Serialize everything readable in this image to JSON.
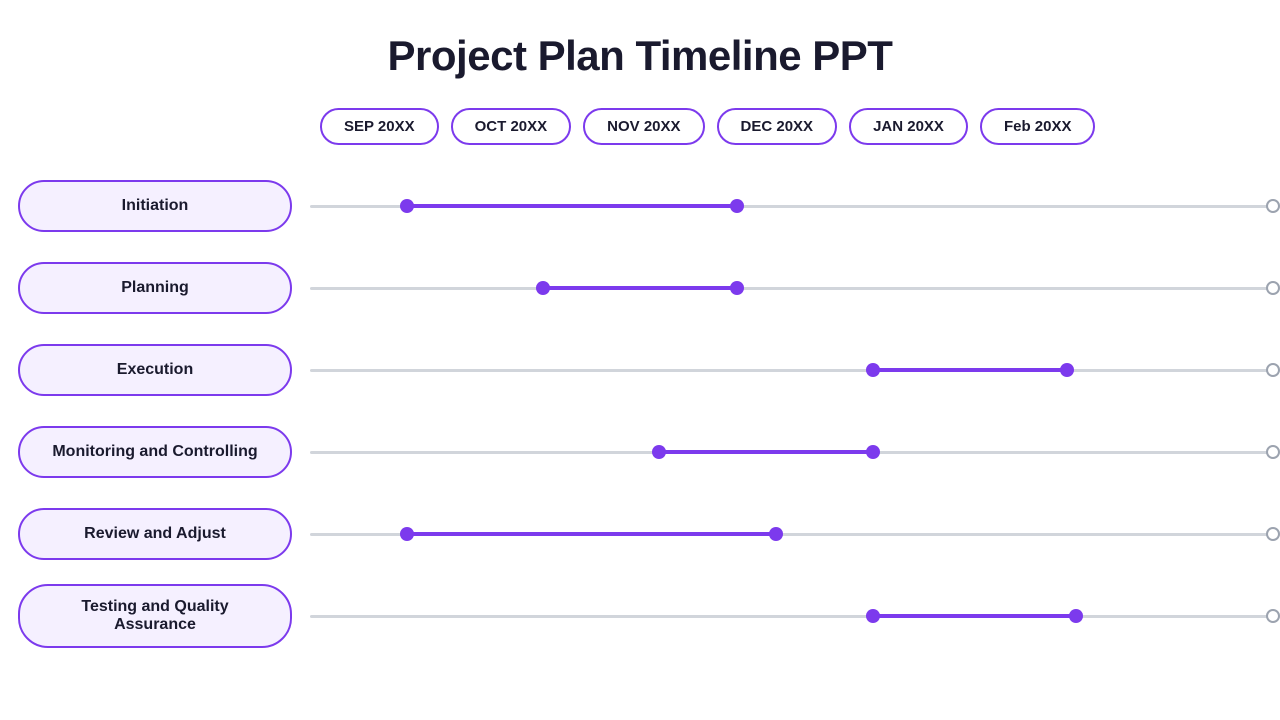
{
  "title": "Project Plan Timeline PPT",
  "months": [
    {
      "label": "SEP 20XX"
    },
    {
      "label": "OCT 20XX"
    },
    {
      "label": "NOV 20XX"
    },
    {
      "label": "DEC 20XX"
    },
    {
      "label": "JAN 20XX"
    },
    {
      "label": "Feb 20XX"
    }
  ],
  "rows": [
    {
      "id": "initiation",
      "label": "Initiation",
      "start_pct": 10,
      "end_pct": 44
    },
    {
      "id": "planning",
      "label": "Planning",
      "start_pct": 24,
      "end_pct": 44
    },
    {
      "id": "execution",
      "label": "Execution",
      "start_pct": 58,
      "end_pct": 78
    },
    {
      "id": "monitoring",
      "label": "Monitoring and Controlling",
      "start_pct": 36,
      "end_pct": 58
    },
    {
      "id": "review",
      "label": "Review and Adjust",
      "start_pct": 10,
      "end_pct": 48
    },
    {
      "id": "testing",
      "label": "Testing and Quality Assurance",
      "start_pct": 58,
      "end_pct": 79
    }
  ],
  "colors": {
    "purple": "#7c3aed",
    "track": "#d1d5db",
    "bg": "#ffffff",
    "label_bg": "#f5f0ff",
    "text_dark": "#1a1a2e"
  }
}
